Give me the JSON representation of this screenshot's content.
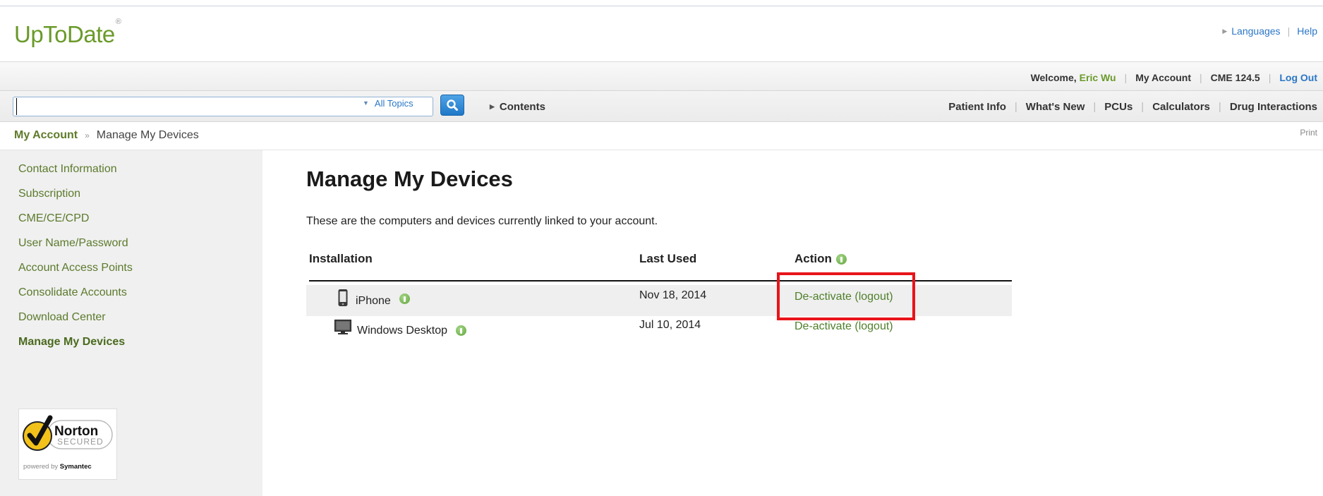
{
  "brand": {
    "logo": "UpToDate",
    "mark": "®"
  },
  "utility_links": {
    "languages": "Languages",
    "help": "Help"
  },
  "welcome_bar": {
    "welcome": "Welcome,",
    "user_name": "Eric Wu",
    "my_account": "My Account",
    "cme": "CME 124.5",
    "log_out": "Log Out"
  },
  "search": {
    "value": "",
    "topics_label": "All Topics",
    "contents_label": "Contents"
  },
  "nav": {
    "patient_info": "Patient Info",
    "whats_new": "What's New",
    "pcus": "PCUs",
    "calculators": "Calculators",
    "drug_interactions": "Drug Interactions"
  },
  "breadcrumb": {
    "root": "My Account",
    "separator": "»",
    "current": "Manage My Devices",
    "print": "Print"
  },
  "sidebar": {
    "items": [
      {
        "label": "Contact Information"
      },
      {
        "label": "Subscription"
      },
      {
        "label": "CME/CE/CPD"
      },
      {
        "label": "User Name/Password"
      },
      {
        "label": "Account Access Points"
      },
      {
        "label": "Consolidate Accounts"
      },
      {
        "label": "Download Center"
      },
      {
        "label": "Manage My Devices",
        "active": true
      }
    ],
    "badge": {
      "title": "Norton",
      "subtitle": "SECURED",
      "footer_prefix": "powered by",
      "footer_brand": "Symantec"
    }
  },
  "main": {
    "title": "Manage My Devices",
    "intro": "These are the computers and devices currently linked to your account.",
    "table": {
      "headers": {
        "installation": "Installation",
        "last_used": "Last Used",
        "action": "Action"
      },
      "rows": [
        {
          "device": "iPhone",
          "icon": "phone-icon",
          "last_used": "Nov 18, 2014",
          "action": "De-activate (logout)"
        },
        {
          "device": "Windows Desktop",
          "icon": "monitor-icon",
          "last_used": "Jul 10, 2014",
          "action": "De-activate (logout)"
        }
      ]
    }
  },
  "colors": {
    "brand_green": "#6a9a2a",
    "link_blue": "#2a76c6",
    "highlight_red": "#e8141a"
  }
}
